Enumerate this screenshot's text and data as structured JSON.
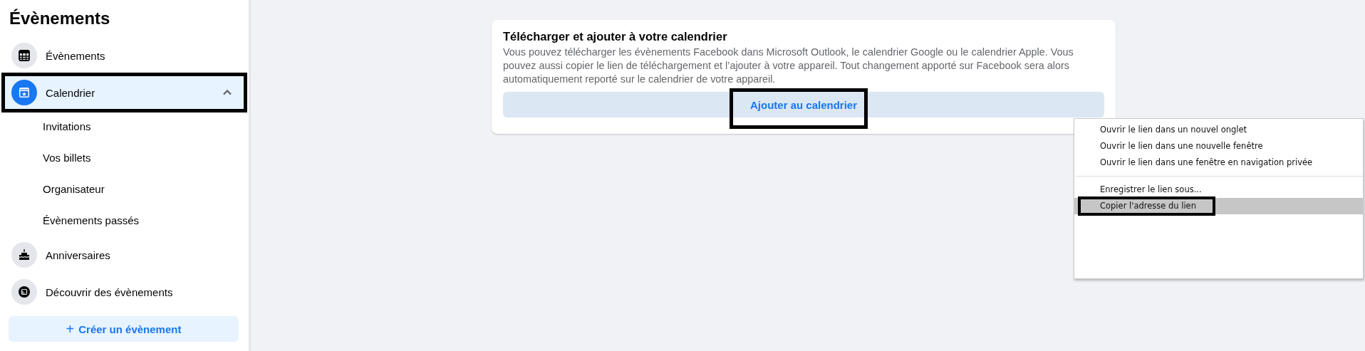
{
  "sidebar": {
    "title": "Évènements",
    "items": [
      {
        "label": "Évènements",
        "selected": false,
        "outlined": false
      },
      {
        "label": "Calendrier",
        "selected": true,
        "outlined": true,
        "expanded": true,
        "children": [
          {
            "label": "Invitations"
          },
          {
            "label": "Vos billets"
          },
          {
            "label": "Organisateur"
          },
          {
            "label": "Évènements passés"
          }
        ]
      },
      {
        "label": "Anniversaires",
        "selected": false,
        "outlined": false
      },
      {
        "label": "Découvrir des évènements",
        "selected": false,
        "outlined": false
      }
    ],
    "create_button": {
      "icon": "+",
      "label": "Créer un évènement"
    }
  },
  "card": {
    "title": "Télécharger et ajouter à votre calendrier",
    "text": "Vous pouvez télécharger les évènements Facebook dans Microsoft Outlook, le calendrier Google ou le calendrier Apple. Vous pouvez aussi copier le lien de téléchargement et l’ajouter à votre appareil. Tout changement apporté sur Facebook sera alors automatiquement reporté sur le calendrier de votre appareil.",
    "button": {
      "label": "Ajouter au calendrier",
      "outlined": true
    }
  },
  "context_menu": {
    "items": [
      {
        "kind": "item",
        "label": "Ouvrir le lien dans un nouvel onglet",
        "highlighted": false,
        "outlined": false
      },
      {
        "kind": "item",
        "label": "Ouvrir le lien dans une nouvelle fenêtre",
        "highlighted": false,
        "outlined": false
      },
      {
        "kind": "item",
        "label": "Ouvrir le lien dans une fenêtre en navigation privée",
        "highlighted": false,
        "outlined": false
      },
      {
        "kind": "separator"
      },
      {
        "kind": "item",
        "label": "Enregistrer le lien sous...",
        "highlighted": false,
        "outlined": false
      },
      {
        "kind": "item",
        "label": "Copier l'adresse du lien",
        "highlighted": true,
        "outlined": true
      }
    ]
  }
}
